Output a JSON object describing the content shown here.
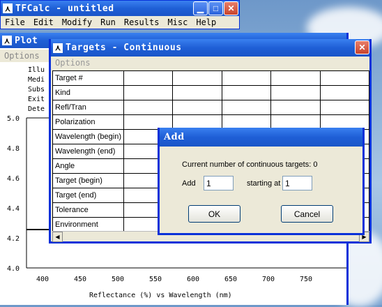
{
  "main_window": {
    "title": "TFCalc - untitled",
    "menu": [
      "File",
      "Edit",
      "Modify",
      "Run",
      "Results",
      "Misc",
      "Help"
    ]
  },
  "plot_window": {
    "title": "Plot",
    "menu": [
      "Options"
    ],
    "info_lines": [
      "Illu",
      "Medi",
      "Subs",
      "Exit",
      "Dete"
    ],
    "y_ticks": [
      "5.0",
      "4.8",
      "4.6",
      "4.4",
      "4.2",
      "4.0"
    ],
    "x_ticks": [
      "400",
      "450",
      "500",
      "550",
      "600",
      "650",
      "700",
      "750"
    ],
    "x_axis_label": "Reflectance (%)  vs  Wavelength (nm)"
  },
  "targets_window": {
    "title": "Targets - Continuous",
    "menu": [
      "Options"
    ],
    "row_labels": [
      "Target #",
      "Kind",
      "Refl/Tran",
      "Polarization",
      "Wavelength (begin)",
      "Wavelength (end)",
      "Angle",
      "Target (begin)",
      "Target (end)",
      "Tolerance",
      "Environment"
    ]
  },
  "add_dialog": {
    "title": "Add",
    "current_count_text": "Current number of continuous targets:  0",
    "add_label": "Add",
    "add_value": "1",
    "starting_at_label": "starting at",
    "starting_at_value": "1",
    "ok_label": "OK",
    "cancel_label": "Cancel"
  },
  "colors": {
    "xp_title_blue": "#1f5fd6",
    "window_face": "#ece9d8",
    "close_red": "#c8442c"
  }
}
